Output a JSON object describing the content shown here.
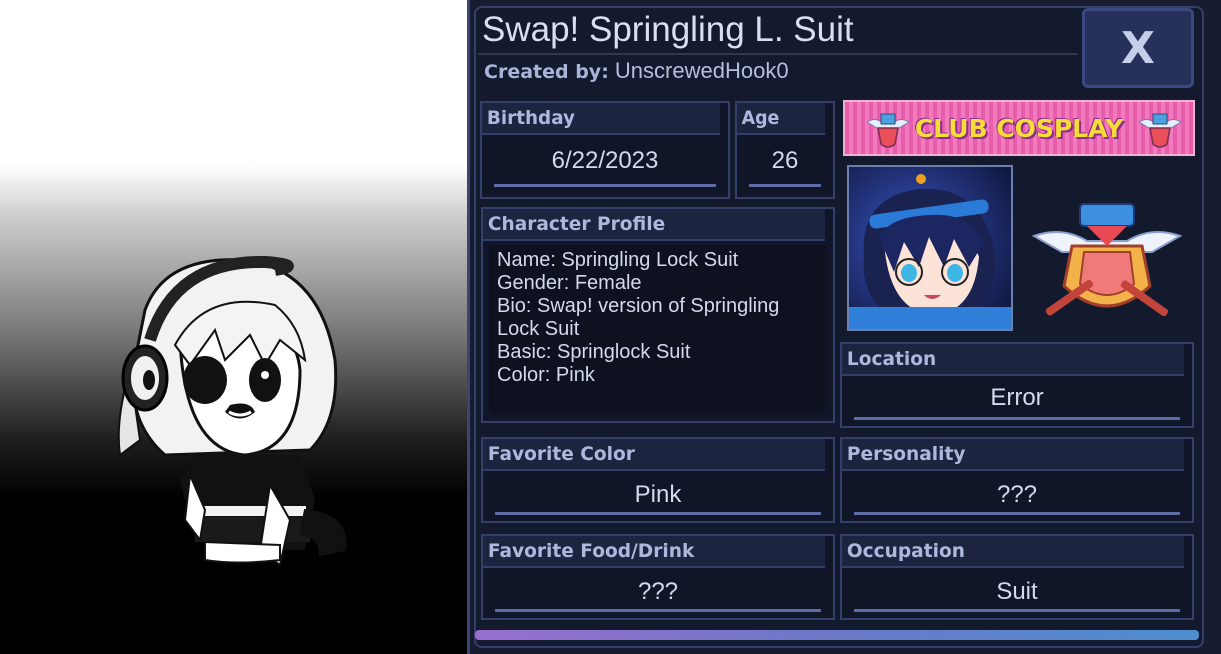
{
  "profile": {
    "title": "Swap! Springling L. Suit",
    "created_by_label": "Created by:",
    "created_by_name": "UnscrewedHook0",
    "close_label": "X"
  },
  "birthday": {
    "label": "Birthday",
    "value": "6/22/2023"
  },
  "age": {
    "label": "Age",
    "value": "26"
  },
  "character_profile": {
    "label": "Character Profile",
    "lines": [
      "Name: Springling Lock Suit",
      "Gender: Female",
      "Bio: Swap! version of Springling",
      "Lock Suit",
      "Basic: Springlock Suit",
      "Color: Pink"
    ]
  },
  "club_banner": {
    "text": "CLUB COSPLAY"
  },
  "location": {
    "label": "Location",
    "value": "Error"
  },
  "favorite_color": {
    "label": "Favorite Color",
    "value": "Pink"
  },
  "personality": {
    "label": "Personality",
    "value": "???"
  },
  "favorite_food": {
    "label": "Favorite Food/Drink",
    "value": "???"
  },
  "occupation": {
    "label": "Occupation",
    "value": "Suit"
  },
  "colors": {
    "panel_bg": "#171c30",
    "field_border": "#34406a",
    "header_text": "#aeb8dc",
    "value_text": "#d4d9ee",
    "banner_pink": "#e85dab",
    "banner_text": "#f6dc38",
    "underline": "#5d6ca6"
  },
  "icons": [
    "close-icon",
    "club-badge-icon",
    "character-avatar",
    "club-emblem-icon"
  ]
}
